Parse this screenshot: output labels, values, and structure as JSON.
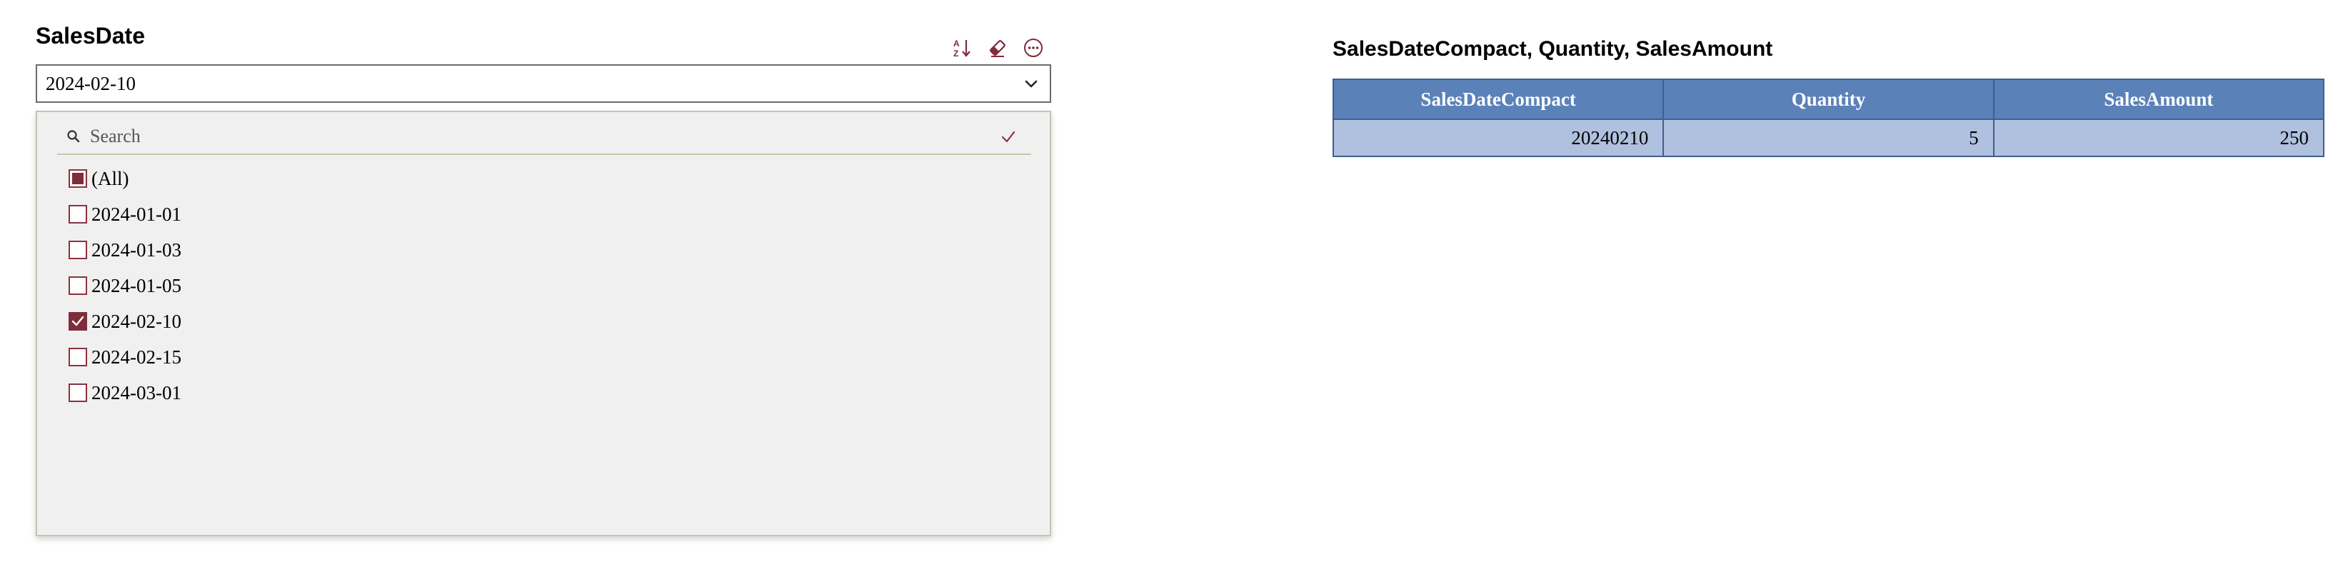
{
  "slicer": {
    "title": "SalesDate",
    "selected_value": "2024-02-10",
    "search_placeholder": "Search",
    "items": [
      {
        "label": "(All)",
        "state": "partial"
      },
      {
        "label": "2024-01-01",
        "state": "unchecked"
      },
      {
        "label": "2024-01-03",
        "state": "unchecked"
      },
      {
        "label": "2024-01-05",
        "state": "unchecked"
      },
      {
        "label": "2024-02-10",
        "state": "checked"
      },
      {
        "label": "2024-02-15",
        "state": "unchecked"
      },
      {
        "label": "2024-03-01",
        "state": "unchecked"
      }
    ],
    "toolbar": {
      "sort_icon": "sort-az-icon",
      "clear_icon": "eraser-icon",
      "more_icon": "more-options-icon"
    }
  },
  "table": {
    "title": "SalesDateCompact, Quantity, SalesAmount",
    "columns": [
      "SalesDateCompact",
      "Quantity",
      "SalesAmount"
    ],
    "rows": [
      [
        "20240210",
        "5",
        "250"
      ]
    ]
  },
  "colors": {
    "accent": "#7d2d3b",
    "header_bg": "#5b81b9",
    "row_bg": "#b0c1df",
    "panel_bg": "#f0f0f0"
  }
}
